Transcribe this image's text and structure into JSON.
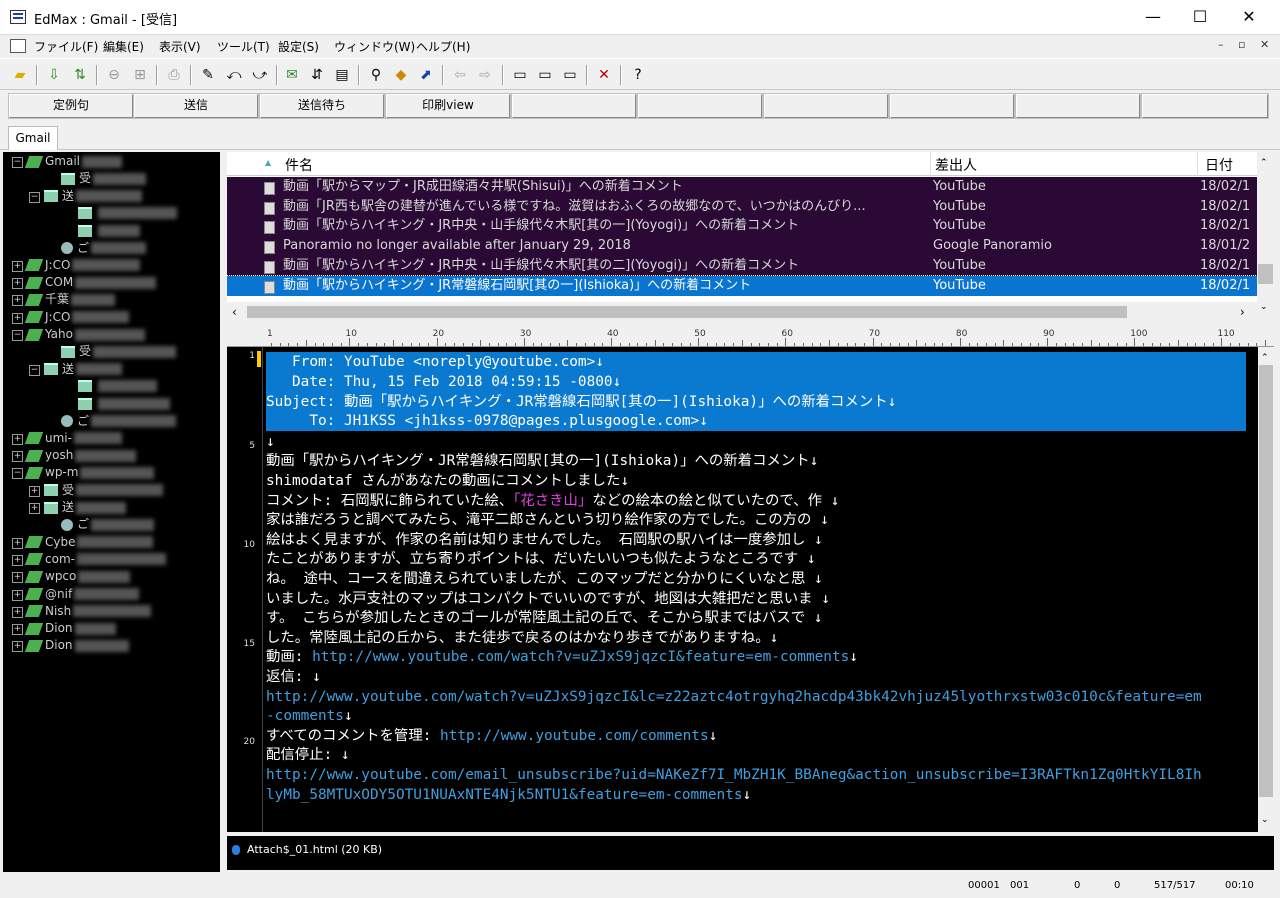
{
  "window": {
    "title": "EdMax : Gmail - [受信]",
    "minimize": "—",
    "maximize": "☐",
    "close": "✕"
  },
  "menu": [
    "ファイル(F)",
    "編集(E)",
    "表示(V)",
    "ツール(T)",
    "設定(S)",
    "ウィンドウ(W)",
    "ヘルプ(H)"
  ],
  "mdi_controls": [
    "–",
    "▫",
    "✕"
  ],
  "fixed_buttons": [
    "定例句",
    "送信",
    "送信待ち",
    "印刷view",
    "",
    "",
    "",
    "",
    "",
    ""
  ],
  "tabs": [
    "Gmail"
  ],
  "tree": [
    {
      "label": "Gmail",
      "expander": "−",
      "indent": 0,
      "icon": "account"
    },
    {
      "label": "受",
      "indent": 2,
      "icon": "folder"
    },
    {
      "label": "送",
      "expander": "−",
      "indent": 1,
      "icon": "folder"
    },
    {
      "label": "",
      "indent": 3,
      "icon": "folder"
    },
    {
      "label": "",
      "indent": 3,
      "icon": "folder"
    },
    {
      "label": "ご",
      "indent": 2,
      "icon": "trash"
    },
    {
      "label": "J:CO",
      "expander": "+",
      "indent": 0,
      "icon": "account"
    },
    {
      "label": "COM",
      "expander": "+",
      "indent": 0,
      "icon": "account"
    },
    {
      "label": "千葉",
      "expander": "+",
      "indent": 0,
      "icon": "account"
    },
    {
      "label": "J:CO",
      "expander": "+",
      "indent": 0,
      "icon": "account"
    },
    {
      "label": "Yaho",
      "expander": "−",
      "indent": 0,
      "icon": "account"
    },
    {
      "label": "受",
      "indent": 2,
      "icon": "folder"
    },
    {
      "label": "送",
      "expander": "−",
      "indent": 1,
      "icon": "folder"
    },
    {
      "label": "",
      "indent": 3,
      "icon": "folder"
    },
    {
      "label": "",
      "indent": 3,
      "icon": "folder"
    },
    {
      "label": "ご",
      "indent": 2,
      "icon": "trash"
    },
    {
      "label": "umi-",
      "expander": "+",
      "indent": 0,
      "icon": "account"
    },
    {
      "label": "yosh",
      "expander": "+",
      "indent": 0,
      "icon": "account"
    },
    {
      "label": "wp-m",
      "expander": "−",
      "indent": 0,
      "icon": "account"
    },
    {
      "label": "受",
      "expander": "+",
      "indent": 1,
      "icon": "folder"
    },
    {
      "label": "送",
      "expander": "+",
      "indent": 1,
      "icon": "folder"
    },
    {
      "label": "ご",
      "indent": 2,
      "icon": "trash"
    },
    {
      "label": "Cybe",
      "expander": "+",
      "indent": 0,
      "icon": "account"
    },
    {
      "label": "com-",
      "expander": "+",
      "indent": 0,
      "icon": "account"
    },
    {
      "label": "wpco",
      "expander": "+",
      "indent": 0,
      "icon": "account"
    },
    {
      "label": "@nif",
      "expander": "+",
      "indent": 0,
      "icon": "account"
    },
    {
      "label": "Nish",
      "expander": "+",
      "indent": 0,
      "icon": "account"
    },
    {
      "label": "Dion",
      "expander": "+",
      "indent": 0,
      "icon": "account"
    },
    {
      "label": "Dion",
      "expander": "+",
      "indent": 0,
      "icon": "account"
    }
  ],
  "list": {
    "columns": {
      "subject": "件名",
      "from": "差出人",
      "date": "日付"
    },
    "rows": [
      {
        "subject": "動画「駅からマップ・JR成田線酒々井駅(Shisui)」への新着コメント",
        "from": "YouTube",
        "date": "18/02/1"
      },
      {
        "subject": "動画「JR西も駅舎の建替が進んでいる様ですね。滋賀はおふくろの故郷なので、いつかはのんびり...",
        "from": "YouTube",
        "date": "18/02/1"
      },
      {
        "subject": "動画「駅からハイキング・JR中央・山手線代々木駅[其の一](Yoyogi)」への新着コメント",
        "from": "YouTube",
        "date": "18/02/1"
      },
      {
        "subject": "Panoramio no longer available after January 29, 2018",
        "from": "Google Panoramio",
        "date": "18/01/2"
      },
      {
        "subject": "動画「駅からハイキング・JR中央・山手線代々木駅[其の二](Yoyogi)」への新着コメント",
        "from": "YouTube",
        "date": "18/02/1"
      },
      {
        "subject": "動画「駅からハイキング・JR常磐線石岡駅[其の一](Ishioka)」への新着コメント",
        "from": "YouTube",
        "date": "18/02/1",
        "selected": true
      }
    ]
  },
  "ruler": [
    "1",
    "10",
    "20",
    "30",
    "40",
    "50",
    "60",
    "70",
    "80",
    "90",
    "100",
    "110"
  ],
  "line_numbers": [
    "1",
    "5",
    "10",
    "15",
    "20"
  ],
  "message": {
    "header": [
      "   From: YouTube <noreply@youtube.com>↓",
      "   Date: Thu, 15 Feb 2018 04:59:15 -0800↓",
      "Subject: 動画「駅からハイキング・JR常磐線石岡駅[其の一](Ishioka)」への新着コメント↓",
      "     To: JH1KSS <jh1kss-0978@pages.plusgoogle.com>↓"
    ],
    "l5": "↓",
    "l6": "動画「駅からハイキング・JR常磐線石岡駅[其の一](Ishioka)」への新着コメント↓",
    "l7": "shimodataf さんがあなたの動画にコメントしました↓",
    "l8a": "コメント: 石岡駅に飾られていた絵、",
    "l8b": "「花さき山」",
    "l8c": "などの絵本の絵と似ていたので、作 ↓",
    "l9": "家は誰だろうと調べてみたら、滝平二郎さんという切り絵作家の方でした。この方の ↓",
    "l10": "絵はよく見ますが、作家の名前は知りませんでした。 石岡駅の駅ハイは一度参加し ↓",
    "l11": "たことがありますが、立ち寄りポイントは、だいたいいつも似たようなところです ↓",
    "l12": "ね。 途中、コースを間違えられていましたが、このマップだと分かりにくいなと思 ↓",
    "l13": "いました。水戸支社のマップはコンパクトでいいのですが、地図は大雑把だと思いま ↓",
    "l14": "す。 こちらが参加したときのゴールが常陸風土記の丘で、そこから駅まではバスで ↓",
    "l15": "した。常陸風土記の丘から、また徒歩で戻るのはかなり歩きでがありますね。↓",
    "l16a": "動画: ",
    "l16b": "http://www.youtube.com/watch?v=uZJxS9jqzcI&feature=em-comments",
    "l16c": "↓",
    "l17": "返信: ↓",
    "l18": "http://www.youtube.com/watch?v=uZJxS9jqzcI&lc=z22aztc4otrgyhq2hacdp43bk42vhjuz45lyothrxstw03c010c&feature=em",
    "l19a": "-comments",
    "l19b": "↓",
    "l20a": "すべてのコメントを管理: ",
    "l20b": "http://www.youtube.com/comments",
    "l20c": "↓",
    "l21": "配信停止: ↓",
    "l22": "http://www.youtube.com/email_unsubscribe?uid=NAKeZf7I_MbZH1K_BBAneg&action_unsubscribe=I3RAFTkn1Zq0HtkYIL8Ih",
    "l23a": "lyMb_58MTUxODY5OTU1NUAxNTE4Njk5NTU1",
    "l23b": "&feature=em-comments",
    "l23c": "↓"
  },
  "attachment": "Attach$_01.html (20 KB)",
  "status": [
    "00001",
    "001",
    "0",
    "0",
    "517/517",
    "00:10"
  ]
}
